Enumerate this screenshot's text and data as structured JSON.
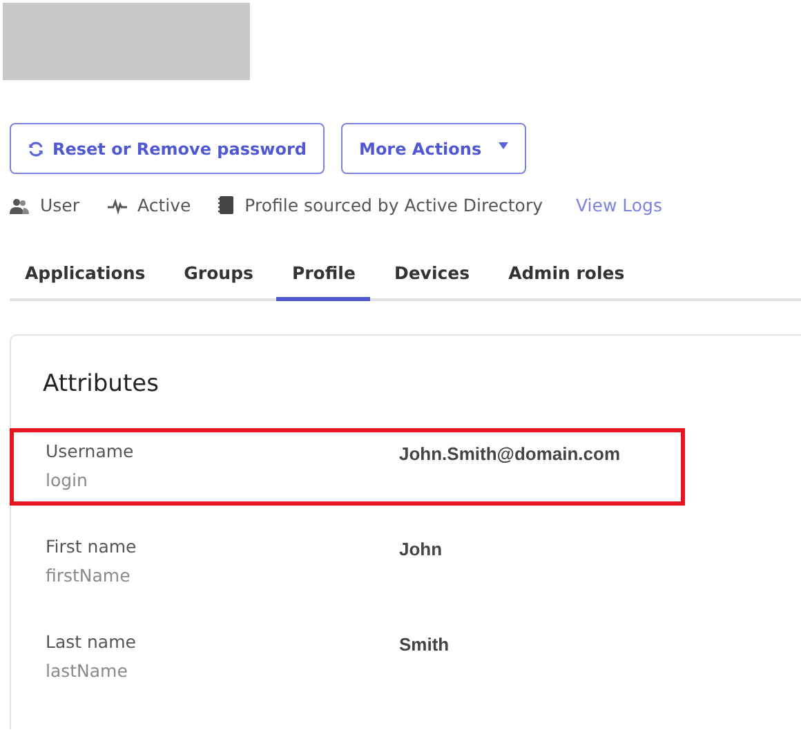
{
  "actions": [
    {
      "kind": "icon-button",
      "label": "Reset or Remove password"
    },
    {
      "kind": "dropdown",
      "label": "More Actions"
    }
  ],
  "meta": [
    {
      "kind": "user",
      "label": "User"
    },
    {
      "kind": "status",
      "label": "Active"
    },
    {
      "kind": "source",
      "label": "Profile sourced by Active Directory"
    },
    {
      "kind": "link",
      "label": "View Logs"
    }
  ],
  "tabs": [
    {
      "label": "Applications",
      "selected": false
    },
    {
      "label": "Groups",
      "selected": false
    },
    {
      "label": "Profile",
      "selected": true
    },
    {
      "label": "Devices",
      "selected": false
    },
    {
      "label": "Admin roles",
      "selected": false
    }
  ],
  "attributes": {
    "title": "Attributes",
    "rows": [
      {
        "label": "Username",
        "variable": "login",
        "value": "John.Smith@domain.com",
        "highlighted": true
      },
      {
        "label": "First name",
        "variable": "firstName",
        "value": "John",
        "highlighted": false
      },
      {
        "label": "Last name",
        "variable": "lastName",
        "value": "Smith",
        "highlighted": false
      }
    ]
  }
}
